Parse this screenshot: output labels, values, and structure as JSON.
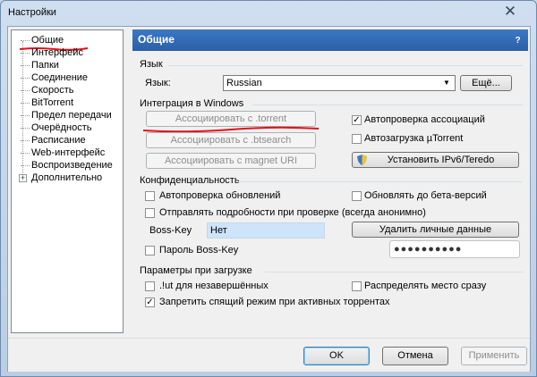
{
  "window": {
    "title": "Настройки",
    "close_glyph": "✕"
  },
  "tree": {
    "items": [
      {
        "label": "Общие"
      },
      {
        "label": "Интерфейс"
      },
      {
        "label": "Папки"
      },
      {
        "label": "Соединение"
      },
      {
        "label": "Скорость"
      },
      {
        "label": "BitTorrent"
      },
      {
        "label": "Предел передачи"
      },
      {
        "label": "Очерёдность"
      },
      {
        "label": "Расписание"
      },
      {
        "label": "Web-интерфейс"
      },
      {
        "label": "Воспроизведение"
      },
      {
        "label": "Дополнительно",
        "expandable": true,
        "expander": "+"
      }
    ]
  },
  "panel": {
    "title": "Общие",
    "help_glyph": "?",
    "language": {
      "group_label": "Язык",
      "field_label": "Язык:",
      "selected": "Russian",
      "more_button": "Ещё..."
    },
    "integration": {
      "group_label": "Интеграция в Windows",
      "assoc_torrent": "Ассоциировать с .torrent",
      "assoc_btsearch": "Ассоциировать с .btsearch",
      "assoc_magnet": "Ассоциировать с magnet URI",
      "auto_check_assoc": {
        "label": "Автопроверка ассоциаций",
        "checked": true
      },
      "autostart": {
        "label": "Автозагрузка µTorrent",
        "checked": false
      },
      "install_ipv6": "Установить IPv6/Teredo"
    },
    "privacy": {
      "group_label": "Конфиденциальность",
      "auto_update": {
        "label": "Автопроверка обновлений",
        "checked": false
      },
      "beta": {
        "label": "Обновлять до бета-версий",
        "checked": false
      },
      "send_details": {
        "label": "Отправлять подробности при проверке (всегда анонимно)",
        "checked": false
      },
      "boss_key_label": "Boss-Key",
      "boss_key_value": "Нет",
      "delete_personal": "Удалить личные данные",
      "boss_key_password": {
        "label": "Пароль Boss-Key",
        "checked": false
      },
      "password_mask": "●●●●●●●●●●"
    },
    "startup": {
      "group_label": "Параметры при загрузке",
      "lut_unfinished": {
        "label": ".!ut для незавершённых",
        "checked": false
      },
      "preallocate": {
        "label": "Распределять место сразу",
        "checked": false
      },
      "prevent_sleep": {
        "label": "Запретить спящий режим при активных торрентах",
        "checked": true
      }
    }
  },
  "buttons": {
    "ok": "OK",
    "cancel": "Отмена",
    "apply": "Применить"
  },
  "check_glyph": "✓",
  "colors": {
    "header_blue": "#2c5fa6",
    "annotation_red": "#e0121b",
    "bosskey_bg": "#cde4fa"
  }
}
